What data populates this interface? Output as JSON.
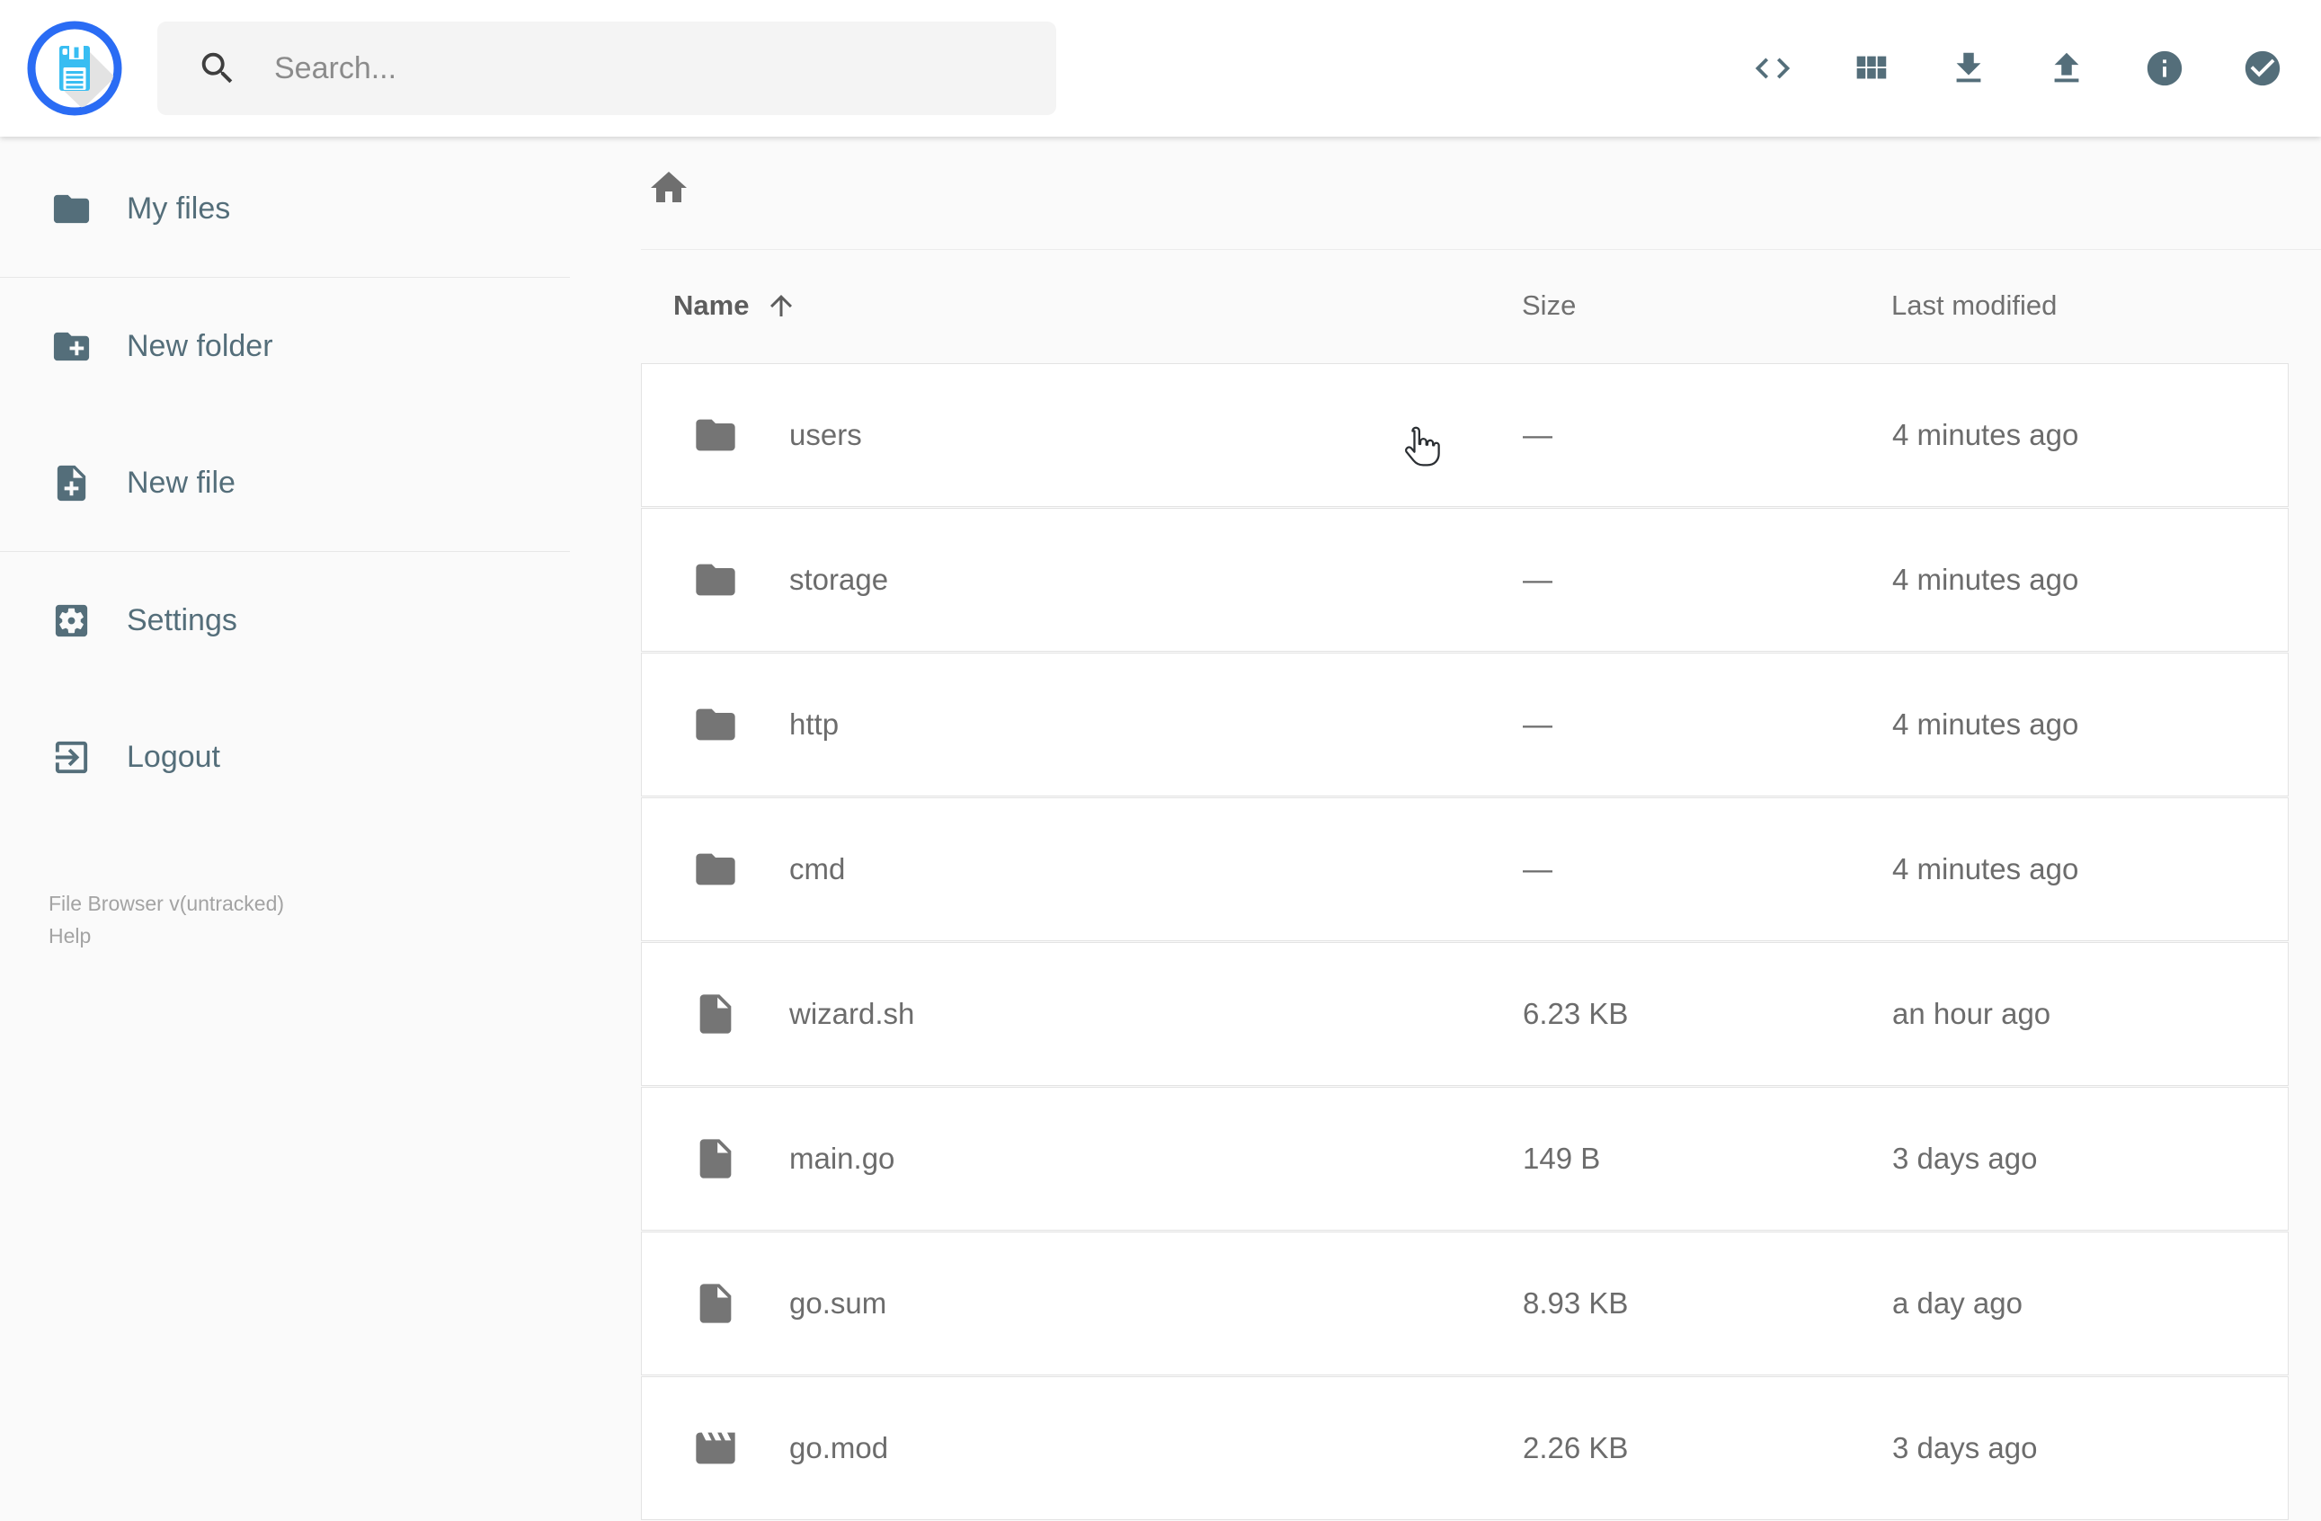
{
  "header": {
    "logo": {
      "icon": "filebrowser-floppy-logo"
    },
    "search": {
      "placeholder": "Search...",
      "icon": "search-icon",
      "value": ""
    },
    "toolbar": {
      "buttons": [
        {
          "id": "shell",
          "icon": "code-icon"
        },
        {
          "id": "switch-view",
          "icon": "grid-view-icon"
        },
        {
          "id": "download",
          "icon": "download-icon"
        },
        {
          "id": "upload",
          "icon": "upload-icon"
        },
        {
          "id": "info",
          "icon": "info-icon"
        },
        {
          "id": "select-multiple",
          "icon": "check-circle-icon"
        }
      ]
    }
  },
  "sidebar": {
    "items": [
      {
        "label": "My files",
        "icon": "folder-icon"
      },
      {
        "label": "New folder",
        "icon": "create-new-folder-icon"
      },
      {
        "label": "New file",
        "icon": "note-add-icon"
      },
      {
        "label": "Settings",
        "icon": "settings-icon"
      },
      {
        "label": "Logout",
        "icon": "exit-to-app-icon"
      }
    ],
    "footer": {
      "version": "File Browser v(untracked)",
      "help": "Help"
    }
  },
  "breadcrumb": {
    "home": {
      "icon": "home-icon"
    }
  },
  "listing": {
    "columns": {
      "name": "Name",
      "size": "Size",
      "modified": "Last modified"
    },
    "sort": {
      "column": "Name",
      "direction": "asc",
      "icon": "arrow-upward-icon"
    },
    "rows": [
      {
        "name": "users",
        "icon": "folder-icon",
        "size": "—",
        "modified": "4 minutes ago"
      },
      {
        "name": "storage",
        "icon": "folder-icon",
        "size": "—",
        "modified": "4 minutes ago"
      },
      {
        "name": "http",
        "icon": "folder-icon",
        "size": "—",
        "modified": "4 minutes ago"
      },
      {
        "name": "cmd",
        "icon": "folder-icon",
        "size": "—",
        "modified": "4 minutes ago"
      },
      {
        "name": "wizard.sh",
        "icon": "file-icon",
        "size": "6.23 KB",
        "modified": "an hour ago"
      },
      {
        "name": "main.go",
        "icon": "file-icon",
        "size": "149 B",
        "modified": "3 days ago"
      },
      {
        "name": "go.sum",
        "icon": "file-icon",
        "size": "8.93 KB",
        "modified": "a day ago"
      },
      {
        "name": "go.mod",
        "icon": "movie-icon",
        "size": "2.26 KB",
        "modified": "3 days ago"
      }
    ]
  },
  "cursor": {
    "icon": "hand-pointer-cursor"
  },
  "colors": {
    "accent_slate": "#546e7a",
    "listing_icon_gray": "#757575",
    "text_gray": "#6c6c6c",
    "logo_blue": "#2a6cf4",
    "logo_cyan": "#38bdf2",
    "page_bg": "#fafafa",
    "card_bg": "#ffffff",
    "border": "#e3e3e3"
  }
}
